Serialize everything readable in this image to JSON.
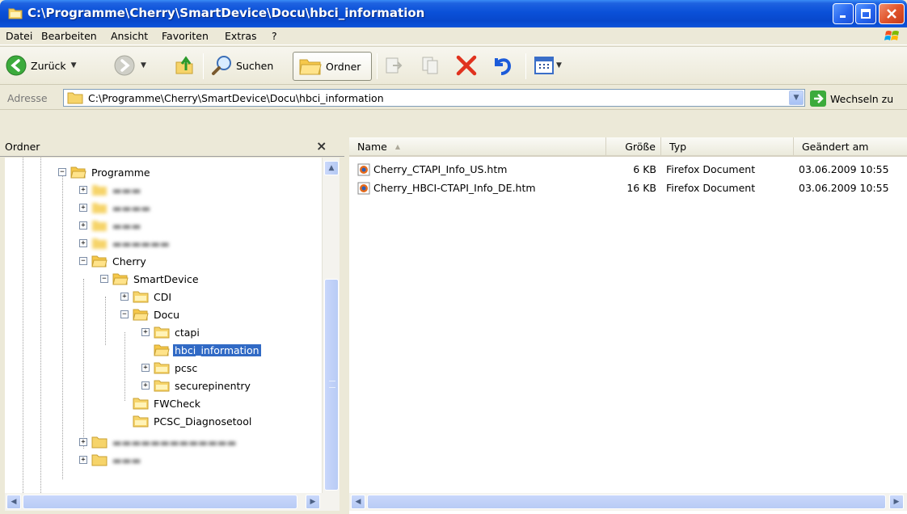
{
  "window": {
    "title": "C:\\Programme\\Cherry\\SmartDevice\\Docu\\hbci_information"
  },
  "menu": [
    {
      "label": "Datei"
    },
    {
      "label": "Bearbeiten"
    },
    {
      "label": "Ansicht"
    },
    {
      "label": "Favoriten"
    },
    {
      "label": "Extras"
    },
    {
      "label": "?"
    }
  ],
  "toolbar": {
    "back_label": "Zurück",
    "search_label": "Suchen",
    "folders_label": "Ordner"
  },
  "address": {
    "label": "Adresse",
    "path": "C:\\Programme\\Cherry\\SmartDevice\\Docu\\hbci_information",
    "go_label": "Wechseln zu"
  },
  "folder_pane": {
    "title": "Ordner",
    "close": "×",
    "tree": [
      {
        "label": "Programme",
        "blurred": false
      },
      {
        "label": "Cherry",
        "blurred": false
      },
      {
        "label": "SmartDevice",
        "blurred": false
      },
      {
        "label": "CDI",
        "blurred": false
      },
      {
        "label": "Docu",
        "blurred": false
      },
      {
        "label": "ctapi",
        "blurred": false
      },
      {
        "label": "hbci_information",
        "blurred": false,
        "selected": true
      },
      {
        "label": "pcsc",
        "blurred": false
      },
      {
        "label": "securepinentry",
        "blurred": false
      },
      {
        "label": "FWCheck",
        "blurred": false
      },
      {
        "label": "PCSC_Diagnosetool",
        "blurred": false
      }
    ]
  },
  "file_list": {
    "columns": [
      "Name",
      "Größe",
      "Typ",
      "Geändert am"
    ],
    "rows": [
      {
        "name": "Cherry_CTAPI_Info_US.htm",
        "size": "6 KB",
        "type": "Firefox Document",
        "modified": "03.06.2009 10:55"
      },
      {
        "name": "Cherry_HBCI-CTAPI_Info_DE.htm",
        "size": "16 KB",
        "type": "Firefox Document",
        "modified": "03.06.2009 10:55"
      }
    ]
  },
  "colors": {
    "titlebar": "#0a50d8",
    "selection": "#316ac5",
    "close_button": "#e1552c"
  }
}
